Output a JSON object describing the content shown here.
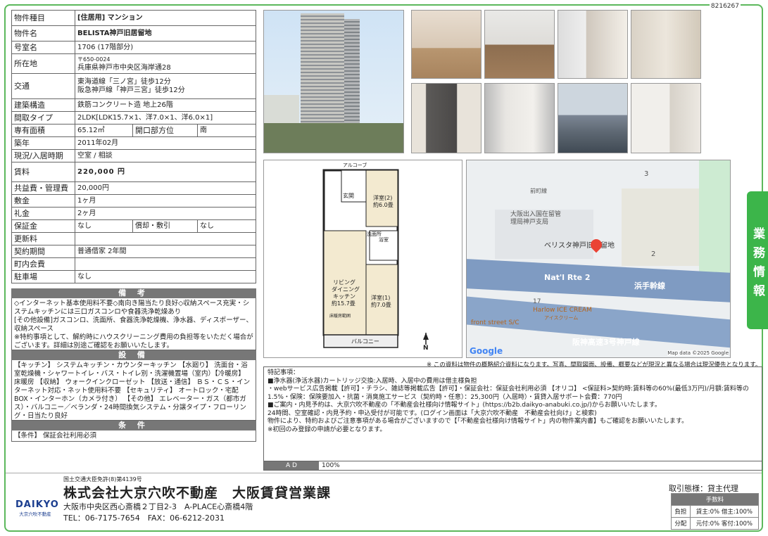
{
  "page_id": "8216267",
  "spec": {
    "type_label": "物件種目",
    "type_value": "[住居用] マンション",
    "name_label": "物件名",
    "name_value": "BELISTA神戸旧居留地",
    "room_label": "号室名",
    "room_value": "1706 (17階部分)",
    "addr_label": "所在地",
    "addr_zip": "〒650-0024",
    "addr_value": "兵庫県神戸市中央区海岸通28",
    "transit_label": "交通",
    "transit_1": "東海道線「三ノ宮」徒歩12分",
    "transit_2": "阪急神戸線「神戸三宮」徒歩12分",
    "struct_label": "建築構造",
    "struct_value": "鉄筋コンクリート造 地上26階",
    "layout_label": "間取タイプ",
    "layout_value": "2LDK[LDK15.7×1、洋7.0×1、洋6.0×1]",
    "area_label": "専有面積",
    "area_value": "65.12㎡",
    "dir_label": "開口部方位",
    "dir_value": "南",
    "built_label": "築年",
    "built_value": "2011年02月",
    "status_label": "現況/入居時期",
    "status_value": "空室 / 相談",
    "rent_label": "賃料",
    "rent_value": "220,000 円",
    "common_label": "共益費・管理費",
    "common_value": "20,000円",
    "deposit_label": "敷金",
    "deposit_value": "1ヶ月",
    "key_label": "礼金",
    "key_value": "2ヶ月",
    "guar_label": "保証金",
    "guar_value": "なし",
    "amort_label": "償却・敷引",
    "amort_value": "なし",
    "renew_label": "更新料",
    "renew_value": "",
    "contract_label": "契約期間",
    "contract_value": "普通借家 2年間",
    "town_label": "町内会費",
    "town_value": "",
    "parking_label": "駐車場",
    "parking_value": "なし"
  },
  "remarks": {
    "title": "備 考",
    "text": "◇インターネット基本使用料不要◇南向き陽当たり良好◇収納スペース充実・システムキッチンには三口ガスコンロや食器洗浄乾燥あり\n[その他設備]ガスコンロ、洗面所、食器洗浄乾燥機、浄水器、ディスポーザー、収納スペース\n※特約事項として、解約時にハウスクリーニング費用の負担等をいただく場合がございます。詳細は別途ご確認をお願いいたします。"
  },
  "equipment": {
    "title": "設 備",
    "text": "【キッチン】 システムキッチン・カウンターキッチン 【水廻り】 洗面台・浴室乾燥機・シャワートイレ・バス・トイレ別・洗濯機置場（室内）【冷暖房】 床暖房 【収納】 ウォークインクローゼット 【放送・通信】 ＢＳ・ＣＳ・インターネット対応・ネット使用料不要 【セキュリティ】 オートロック・宅配BOX・インターホン（カメラ付き） 【その他】 エレベーター・ガス（都市ガス）・バルコニー／ベランダ・24時間換気システム・分譲タイプ・フローリング・日当たり良好"
  },
  "conditions": {
    "title": "条 件",
    "text": "【条件】 保証会社利用必須"
  },
  "disclaimer": "※ この資料は物件の概略紹介資料になります。写真、間取図面、設備、概要などが現況と異なる場合は現況優先となります。",
  "floorplan": {
    "alcove": "アルコーブ",
    "entrance": "玄関",
    "bed2": "洋室(2)",
    "bed2_size": "約6.0畳",
    "bath": "浴室",
    "wash": "洗面所",
    "living1": "リビング",
    "living2": "ダイニング",
    "living3": "キッチン",
    "living_size": "約15.7畳",
    "bed1": "洋室(1)",
    "bed1_size": "約7.0畳",
    "balcony": "バルコニー",
    "floor_heat": "床暖房範囲",
    "north": "N"
  },
  "map": {
    "label_immig": "大阪出入国在留管理局神戸支局",
    "label_bldg": "ベリスタ神戸旧居留地",
    "road1": "Nat'l Rte 2",
    "road2": "浜手幹線",
    "road3": "阪神高速3号神戸線",
    "shop1": "Harlow ICE CREAM",
    "shop1_sub": "アイスクリーム",
    "shop2": "front street S/C",
    "street_top": "前町線",
    "num3": "3",
    "num2": "2",
    "num17": "17",
    "google": "Google",
    "copyright": "Map data ©2025 Google"
  },
  "notes": {
    "title": "特記事項：",
    "line1": "■浄水器(浄活水器)カートリッジ交換:入居時、入居中の費用は借主様負担",
    "line2": "・webサービス広告掲載【許可】・チラシ、雑誌等掲載広告【許可】・保証会社：保証会社利用必須 【オリコ】 <保証料>契約時:賃料等の60%(最低3万円)/月額:賃料等の1.5%・保険：保険要加入・抗菌・消臭施工サービス（契約時・任意）：25,300円（入居時）・賃貸入居サポート会費：770円",
    "line3": "■ご案内・内見予約は、大京穴吹不動産の「不動産会社様向け情報サイト」(https://b2b.daikyo-anabuki.co.jp/)からお願いいたします。",
    "line4": "24時間、空室確認・内見予約・申込受付が可能です。(ログイン画面は「大京穴吹不動産　不動産会社向け」と検索)",
    "line5": "物件により、特約およびご注意事項がある場合がございますので【「不動産会社様向け情報サイト」内の物件案内書】もご確認をお願いいたします。",
    "line6": "※初回のみ登録の申請が必要となります。"
  },
  "ad": {
    "label": "A D",
    "value": "100%"
  },
  "side_tab": "業務情報",
  "footer": {
    "license": "国土交通大臣免許(8)第4139号",
    "company": "株式会社大京穴吹不動産　大阪賃貸営業課",
    "address": "大阪市中央区西心斎橋２丁目2-3　A-PLACE心斎橋4階",
    "tel": "TEL：06-7175-7654　FAX：06-6212-2031",
    "logo_main": "DAIKYO",
    "logo_sub": "大京穴吹不動産",
    "trade": "取引態様：貸主代理",
    "fee_head": "手数料",
    "fee_r1_lbl": "負担",
    "fee_r1_val": "貸主:0%  借主:100%",
    "fee_r2_lbl": "分配",
    "fee_r2_val": "元付:0%  客付:100%"
  }
}
